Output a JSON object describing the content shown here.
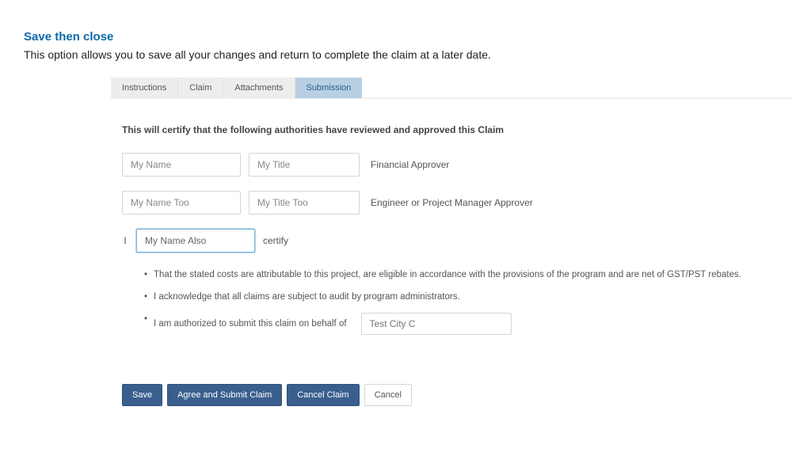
{
  "header": {
    "title": "Save then close",
    "description": "This option allows you to save all your changes and return to complete the claim at a later date."
  },
  "tabs": {
    "items": [
      {
        "label": "Instructions",
        "active": false
      },
      {
        "label": "Claim",
        "active": false
      },
      {
        "label": "Attachments",
        "active": false
      },
      {
        "label": "Submission",
        "active": true
      }
    ]
  },
  "form": {
    "certification_heading": "This will certify that the following authorities have reviewed and approved this Claim",
    "approvers": [
      {
        "name": "My Name",
        "title": "My Title",
        "role": "Financial Approver"
      },
      {
        "name": "My Name Too",
        "title": "My Title Too",
        "role": "Engineer or Project Manager Approver"
      }
    ],
    "self_certify": {
      "prefix": "I",
      "name": "My Name Also",
      "suffix": "certify"
    },
    "bullets": {
      "b1": "That the stated costs are attributable to this project, are eligible in accordance with the provisions of the program and are net of GST/PST rebates.",
      "b2": "I acknowledge that all claims are subject to audit by program administrators.",
      "b3_prefix": "I am authorized to submit this claim on behalf of",
      "b3_value": "Test City C"
    }
  },
  "buttons": {
    "save": "Save",
    "agree_submit": "Agree and Submit Claim",
    "cancel_claim": "Cancel Claim",
    "cancel": "Cancel"
  }
}
